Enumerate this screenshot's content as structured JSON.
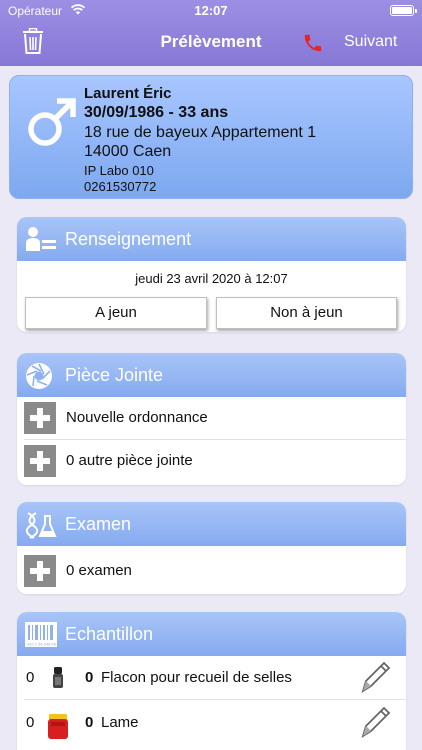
{
  "status_bar": {
    "carrier": "Opérateur",
    "time": "12:07"
  },
  "nav": {
    "title": "Prélèvement",
    "next_label": "Suivant"
  },
  "patient": {
    "name": "Laurent Éric",
    "birth": "30/09/1986 - 33 ans",
    "street": "18 rue de bayeux Appartement 1",
    "city": "14000 Caen",
    "lab": "IP Labo 010",
    "phone": "0261530772"
  },
  "renseignement": {
    "title": "Renseignement",
    "date": "jeudi 23 avril 2020 à 12:07",
    "fasting_label": "A jeun",
    "not_fasting_label": "Non à jeun"
  },
  "piece_jointe": {
    "title": "Pièce Jointe",
    "items": [
      {
        "label": "Nouvelle ordonnance"
      },
      {
        "label": "0 autre pièce jointe"
      }
    ]
  },
  "examen": {
    "title": "Examen",
    "items": [
      {
        "label": "0 examen"
      }
    ]
  },
  "echantillon": {
    "title": "Echantillon",
    "barcode_text": "432 1 56 348 46",
    "samples": [
      {
        "count": "0",
        "qty": "0",
        "name": "Flacon pour recueil de selles",
        "cap_color": "#222222"
      },
      {
        "count": "0",
        "qty": "0",
        "name": "Lame",
        "cap_color": "#d81f1f"
      }
    ]
  },
  "colors": {
    "nav": "#8a7cd9",
    "section_header": "#8fb1f2",
    "background": "#ebe9f6"
  }
}
